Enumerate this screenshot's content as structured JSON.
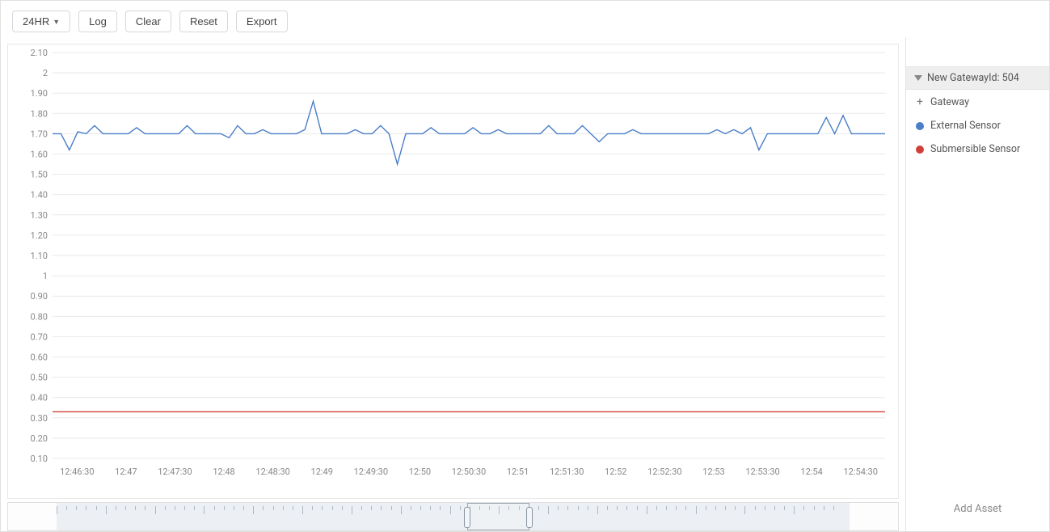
{
  "toolbar": {
    "range_label": "24HR",
    "log_label": "Log",
    "clear_label": "Clear",
    "reset_label": "Reset",
    "export_label": "Export"
  },
  "sidebar": {
    "gateway_header": "New GatewayId: 504",
    "add_gateway_label": "Gateway",
    "series": [
      {
        "label": "External Sensor",
        "color": "#4a7ec8"
      },
      {
        "label": "Submersible Sensor",
        "color": "#d04038"
      }
    ],
    "add_asset_label": "Add Asset"
  },
  "chart_data": {
    "type": "line",
    "xlabel": "",
    "ylabel": "",
    "ylim": [
      0.1,
      2.1
    ],
    "y_ticks": [
      2.1,
      2,
      1.9,
      1.8,
      1.7,
      1.6,
      1.5,
      1.4,
      1.3,
      1.2,
      1.1,
      1,
      0.9,
      0.8,
      0.7,
      0.6,
      0.5,
      0.4,
      0.3,
      0.2,
      0.1
    ],
    "x_ticks": [
      "12:46:30",
      "12:47",
      "12:47:30",
      "12:48",
      "12:48:30",
      "12:49",
      "12:49:30",
      "12:50",
      "12:50:30",
      "12:51",
      "12:51:30",
      "12:52",
      "12:52:30",
      "12:53",
      "12:53:30",
      "12:54",
      "12:54:30"
    ],
    "series": [
      {
        "name": "External Sensor",
        "color": "#4a7ec8",
        "values": [
          1.7,
          1.7,
          1.62,
          1.71,
          1.7,
          1.74,
          1.7,
          1.7,
          1.7,
          1.7,
          1.73,
          1.7,
          1.7,
          1.7,
          1.7,
          1.7,
          1.74,
          1.7,
          1.7,
          1.7,
          1.7,
          1.68,
          1.74,
          1.7,
          1.7,
          1.72,
          1.7,
          1.7,
          1.7,
          1.7,
          1.72,
          1.86,
          1.7,
          1.7,
          1.7,
          1.7,
          1.72,
          1.7,
          1.7,
          1.74,
          1.7,
          1.55,
          1.7,
          1.7,
          1.7,
          1.73,
          1.7,
          1.7,
          1.7,
          1.7,
          1.73,
          1.7,
          1.7,
          1.72,
          1.7,
          1.7,
          1.7,
          1.7,
          1.7,
          1.74,
          1.7,
          1.7,
          1.7,
          1.74,
          1.7,
          1.66,
          1.7,
          1.7,
          1.7,
          1.72,
          1.7,
          1.7,
          1.7,
          1.7,
          1.7,
          1.7,
          1.7,
          1.7,
          1.7,
          1.72,
          1.7,
          1.72,
          1.7,
          1.73,
          1.62,
          1.7,
          1.7,
          1.7,
          1.7,
          1.7,
          1.7,
          1.7,
          1.78,
          1.7,
          1.79,
          1.7,
          1.7,
          1.7,
          1.7,
          1.7
        ]
      },
      {
        "name": "Submersible Sensor",
        "color": "#d04038",
        "values": [
          0.33,
          0.33,
          0.33,
          0.33,
          0.33,
          0.33,
          0.33,
          0.33,
          0.33,
          0.33,
          0.33,
          0.33,
          0.33,
          0.33,
          0.33,
          0.33,
          0.33,
          0.33,
          0.33,
          0.33,
          0.33,
          0.33,
          0.33,
          0.33,
          0.33,
          0.33,
          0.33,
          0.33,
          0.33,
          0.33,
          0.33,
          0.33,
          0.33,
          0.33,
          0.33,
          0.33,
          0.33,
          0.33,
          0.33,
          0.33,
          0.33,
          0.33,
          0.33,
          0.33,
          0.33,
          0.33,
          0.33,
          0.33,
          0.33,
          0.33,
          0.33,
          0.33,
          0.33,
          0.33,
          0.33,
          0.33,
          0.33,
          0.33,
          0.33,
          0.33,
          0.33,
          0.33,
          0.33,
          0.33,
          0.33,
          0.33,
          0.33,
          0.33,
          0.33,
          0.33,
          0.33,
          0.33,
          0.33,
          0.33,
          0.33,
          0.33,
          0.33,
          0.33,
          0.33,
          0.33,
          0.33,
          0.33,
          0.33,
          0.33,
          0.33,
          0.33,
          0.33,
          0.33,
          0.33,
          0.33,
          0.33,
          0.33,
          0.33,
          0.33,
          0.33,
          0.33,
          0.33,
          0.33,
          0.33,
          0.33
        ]
      }
    ],
    "brush": {
      "window_start_frac": 0.52,
      "window_end_frac": 0.59
    }
  }
}
